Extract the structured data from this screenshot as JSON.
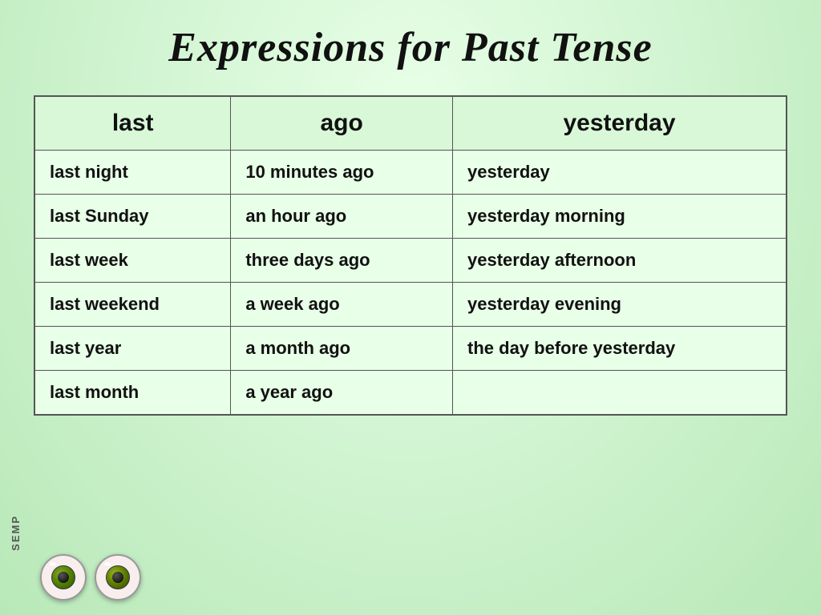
{
  "title": "Expressions for Past Tense",
  "watermark": "SEMP",
  "table": {
    "headers": [
      "last",
      "ago",
      "yesterday"
    ],
    "rows": [
      [
        "last night",
        "10 minutes ago",
        "yesterday"
      ],
      [
        "last Sunday",
        "an hour ago",
        "yesterday morning"
      ],
      [
        "last week",
        "three days ago",
        "yesterday afternoon"
      ],
      [
        "last weekend",
        "a week ago",
        "yesterday evening"
      ],
      [
        "last year",
        "a month ago",
        "the day before yesterday"
      ],
      [
        "last month",
        "a year ago",
        ""
      ]
    ]
  }
}
